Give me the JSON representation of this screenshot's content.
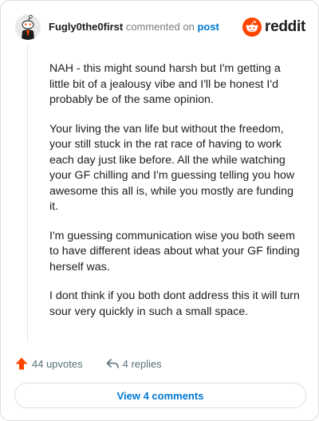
{
  "comment": {
    "username": "Fugly0the0first",
    "action_text": "commented on",
    "post_link": "post",
    "paragraphs": [
      "NAH - this might sound harsh but I'm getting a little bit of a jealousy vibe and I'll be honest I'd probably be of the same opinion.",
      "Your living the van life but without the freedom, your still stuck in the rat race of having to work each day just like before. All the while watching your GF chilling and I'm guessing telling you how awesome this all is, while you mostly are funding it.",
      "I'm guessing communication wise you both seem to have different ideas about what your GF finding herself was.",
      "I dont think if you both dont address this it will turn sour very quickly in such a small space."
    ],
    "upvotes": "44 upvotes",
    "replies": "4 replies",
    "view_comments": "View 4 comments"
  },
  "brand": {
    "logo_text": "reddit",
    "accent_color": "#ff4500",
    "link_color": "#0079d3"
  },
  "icons": {
    "avatar": "snoo-avatar",
    "logo": "reddit-snoo-icon",
    "upvote": "upvote-arrow-icon",
    "reply": "reply-arrow-icon"
  }
}
